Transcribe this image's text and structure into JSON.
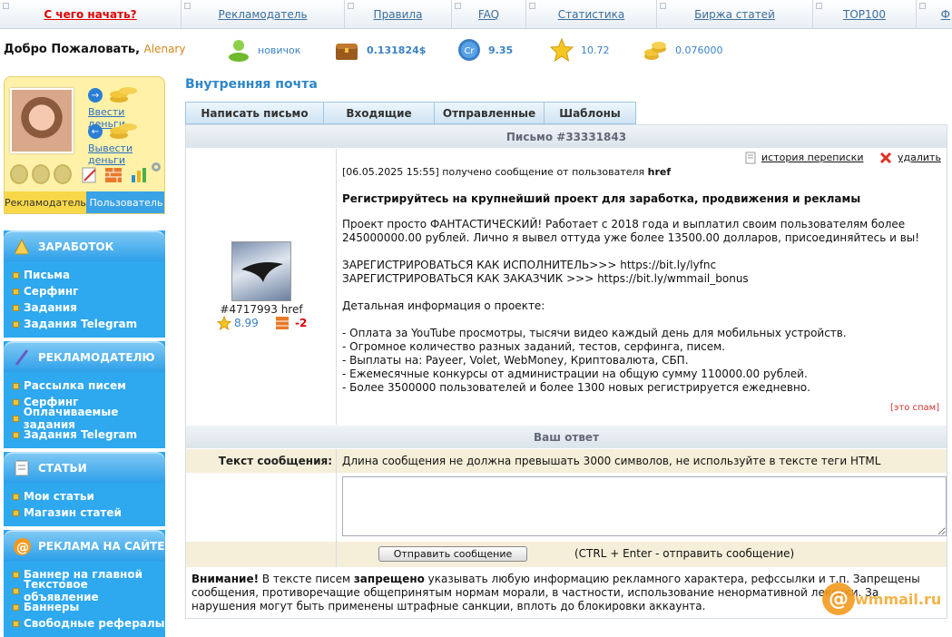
{
  "nav": {
    "items": [
      "С чего начать?",
      "Рекламодатель",
      "Правила",
      "FAQ",
      "Статистика",
      "Биржа статей",
      "TOP100",
      "Ф"
    ]
  },
  "header": {
    "welcome": "Добро Пожаловать,",
    "username": "Alenary",
    "status": "новичок",
    "balance": "0.131824$",
    "cr": "9.35",
    "rating": "10.72",
    "coins": "0.076000"
  },
  "userbox": {
    "deposit": "Ввести деньги",
    "withdraw": "Вывести деньги",
    "role_advertiser": "Рекламодатель",
    "role_user": "Пользователь"
  },
  "menu": {
    "earn": {
      "title": "ЗАРАБОТОК",
      "items": [
        "Письма",
        "Серфинг",
        "Задания",
        "Задания Telegram"
      ]
    },
    "adv": {
      "title": "РЕКЛАМОДАТЕЛЮ",
      "items": [
        "Рассылка писем",
        "Серфинг",
        "Оплачиваемые задания",
        "Задания Telegram"
      ]
    },
    "articles": {
      "title": "СТАТЬИ",
      "items": [
        "Мои статьи",
        "Магазин статей"
      ]
    },
    "site": {
      "title": "РЕКЛАМА НА САЙТЕ",
      "items": [
        "Баннер на главной",
        "Текстовое объявление",
        "Баннеры",
        "Свободные рефералы"
      ]
    }
  },
  "main": {
    "title": "Внутренняя почта",
    "tabs": [
      "Написать письмо",
      "Входящие",
      "Отправленные",
      "Шаблоны"
    ],
    "letter_header": "Письмо #33331843",
    "history": "история переписки",
    "delete": "удалить",
    "sender_id": "#4717993 href",
    "sender_rating": "8.99",
    "sender_score": "-2",
    "meta_date": "[06.05.2025 15:55]",
    "meta_text": "получено сообщение от пользователя",
    "meta_user": "href",
    "subject": "Регистрируйтесь на крупнейший проект для заработка, продвижения и рекламы",
    "body_p1": "Проект просто ФАНТАСТИЧЕСКИЙ! Работает с 2018 года и выплатил своим пользователям более 245000000.00 рублей. Лично я вывел оттуда уже более 13500.00 долларов, присоединяйтесь и вы!",
    "reg_exec": "ЗАРЕГИСТРИРОВАТЬСЯ КАК ИСПОЛНИТЕЛЬ>>>",
    "reg_exec_link": "https://bit.ly/lyfnc",
    "reg_cust": "ЗАРЕГИСТРИРОВАТЬСЯ КАК ЗАКАЗЧИК >>>",
    "reg_cust_link": "https://bit.ly/wmmail_bonus",
    "details": "Детальная информация о проекте:",
    "bullets": [
      "- Оплата за YouTube просмотры, тысячи видео каждый день для мобильных устройств.",
      "- Огромное количество разных заданий, тестов, серфинга, писем.",
      "- Выплаты на: Payeer, Volet, WebMoney, Криптовалюта, СБП.",
      "- Ежемесячные конкурсы от администрации на общую сумму 110000.00 рублей.",
      "- Более 3500000 пользователей и более 1300 новых регистрируется ежедневно."
    ],
    "spam": "[это спам]",
    "reply_header": "Ваш ответ",
    "text_label": "Текст сообщения:",
    "text_hint": "Длина сообщения не должна превышать 3000 символов, не используйте в тексте теги HTML",
    "send_button": "Отправить сообщение",
    "send_hint": "(CTRL + Enter - отправить сообщение)",
    "warn_bold1": "Внимание!",
    "warn_t1": " В тексте писем ",
    "warn_bold2": "запрещено",
    "warn_t2": " указывать любую информацию рекламного характера, рефссылки и т.п. Запрещены сообщения, противоречащие общепринятым нормам морали, в частности, использование ненормативной лексики. За нарушения могут быть применены штрафные санкции, вплоть до блокировки аккаунта.",
    "logo": "wmmail.ru"
  },
  "colors": {
    "accent": "#2e86c9",
    "sidebar": "#2ea8ef",
    "userbox": "#fff2a8",
    "danger": "#e00000"
  }
}
